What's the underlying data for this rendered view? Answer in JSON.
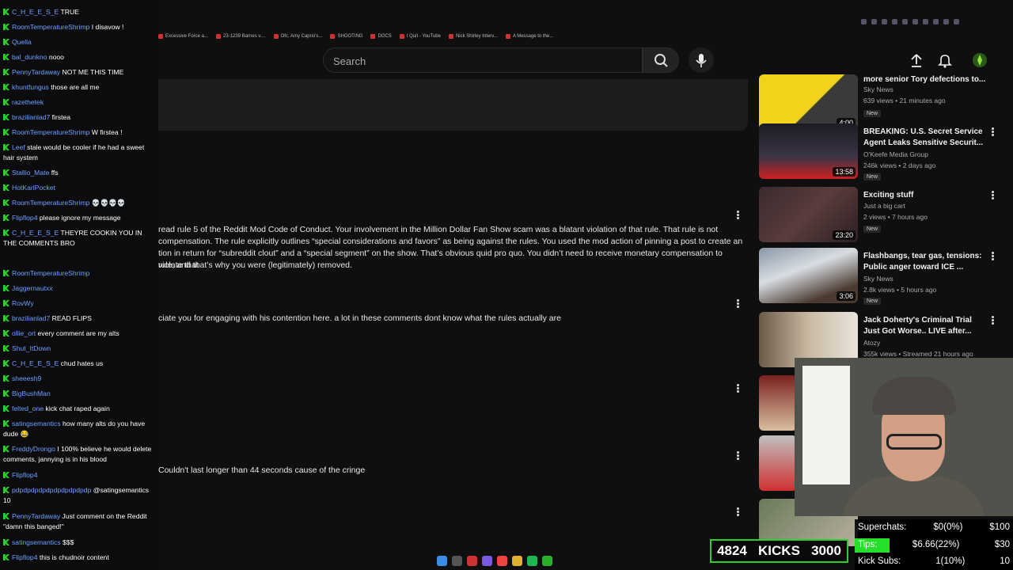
{
  "browser": {
    "bookmarks": [
      "Excessive Force a...",
      "23-1239 Barnes v....",
      "Ofc. Amy Caprio's...",
      "SHOOTING",
      "DOCS",
      "I Quit - YouTube",
      "Nick Shirley Interv...",
      "A Message to the..."
    ]
  },
  "youtube": {
    "search_placeholder": "Search",
    "comments": [
      {
        "text": "read rule 5 of the Reddit Mod Code of Conduct. Your involvement in the Million Dollar Fan Show scam was a blatant violation of that rule. That rule is not"
      },
      {
        "text": "compensation. The rule explicitly outlines “special considerations and favors” as being against the rules. You used the mod action of pinning a post to create an"
      },
      {
        "text": "tion in return for “subreddit clout” and a “special segment” on the show. That’s obvious quid pro quo. You didn’t need to receive monetary compensation to violate that"
      },
      {
        "text": "rule, and that’s why you were (legitimately) removed."
      },
      {
        "text": "ciate you for engaging with his contention here. a lot in these comments dont know what the rules actually are"
      },
      {
        "text": "Couldn't last longer than 44 seconds cause of the cringe"
      }
    ],
    "videos": [
      {
        "title": "more senior Tory defections to...",
        "channel": "Sky News",
        "meta": "639 views • 21 minutes ago",
        "badge": "New",
        "duration": "4:00"
      },
      {
        "title": "BREAKING: U.S. Secret Service Agent Leaks Sensitive Securit...",
        "channel": "O'Keefe Media Group",
        "meta": "246k views • 2 days ago",
        "badge": "New",
        "duration": "13:58"
      },
      {
        "title": "Exciting stuff",
        "channel": "Just a big cart",
        "meta": "2 views • 7 hours ago",
        "badge": "New",
        "duration": "23:20"
      },
      {
        "title": "Flashbangs, tear gas, tensions: Public anger toward ICE ...",
        "channel": "Sky News",
        "meta": "2.8k views • 5 hours ago",
        "badge": "New",
        "duration": "3:06"
      },
      {
        "title": "Jack Doherty's Criminal Trial Just Got Worse.. LIVE after...",
        "channel": "Atozy",
        "meta": "355k views • Streamed 21 hours ago",
        "badge": "",
        "duration": ""
      }
    ]
  },
  "chat": {
    "messages": [
      {
        "user": "C_H_E_E_S_E",
        "text": "TRUE"
      },
      {
        "user": "RoomTemperatureShrimp",
        "text": "I disavow !"
      },
      {
        "user": "Quella",
        "text": ""
      },
      {
        "user": "bal_dunkno",
        "text": "nooo"
      },
      {
        "user": "PennyTardaway",
        "text": "NOT ME THIS TIME"
      },
      {
        "user": "khuntfungus",
        "text": "those are all me"
      },
      {
        "user": "razethetek",
        "text": ""
      },
      {
        "user": "brazilianlad7",
        "text": "firstea"
      },
      {
        "user": "RoomTemperatureShrimp",
        "text": "W firstea !"
      },
      {
        "user": "Leef",
        "text": "stale would be cooler if he had a sweet hair system"
      },
      {
        "user": "Stallio_Mate",
        "text": "ffs"
      },
      {
        "user": "HotKarlPocket",
        "text": ""
      },
      {
        "user": "RoomTemperatureShrimp",
        "text": "💀💀💀💀"
      },
      {
        "user": "Flipflop4",
        "text": "please ignore my message"
      },
      {
        "user": "C_H_E_E_S_E",
        "text": "THEYRE COOKIN YOU IN THE COMMENTS BRO"
      },
      {
        "user": "RoomTemperatureShrimp",
        "text": ""
      },
      {
        "user": "Jaggernautxx",
        "text": ""
      },
      {
        "user": "RovWy",
        "text": ""
      },
      {
        "user": "brazilianlad7",
        "text": "READ FLIPS"
      },
      {
        "user": "ollie_ort",
        "text": "every comment are my alts"
      },
      {
        "user": "Shut_ItDown",
        "text": ""
      },
      {
        "user": "C_H_E_E_S_E",
        "text": "chud hates us"
      },
      {
        "user": "sheeesh9",
        "text": ""
      },
      {
        "user": "BigBushMan",
        "text": ""
      },
      {
        "user": "felted_one",
        "text": "kick chat raped again"
      },
      {
        "user": "satingsemantics",
        "text": "how many alts do you have dude 😂"
      },
      {
        "user": "FreddyDrongo",
        "text": "I 100% believe he would delete comments, jannying is in his blood"
      },
      {
        "user": "Flipflop4",
        "text": ""
      },
      {
        "user": "pdpdpdpdpdpdpdpdpdpdp",
        "text": "@satingsemantics 10"
      },
      {
        "user": "PennyTardaway",
        "text": "Just comment on the Reddit \"damn this banged!\""
      },
      {
        "user": "satingsemantics",
        "text": "$$$"
      },
      {
        "user": "Flipflop4",
        "text": "this is chudnoir content"
      }
    ]
  },
  "overlay": {
    "kicks_count": "4824",
    "kicks_label": "KICKS",
    "kicks_goal": "3000",
    "stats": [
      {
        "label": "Superchats:",
        "value": "$0(0%)",
        "goal": "$100"
      },
      {
        "label": "Tips:",
        "value": "$6.66(22%)",
        "goal": "$30"
      },
      {
        "label": "Kick Subs:",
        "value": "1(10%)",
        "goal": "10"
      }
    ],
    "tips_progress": 0.22
  }
}
